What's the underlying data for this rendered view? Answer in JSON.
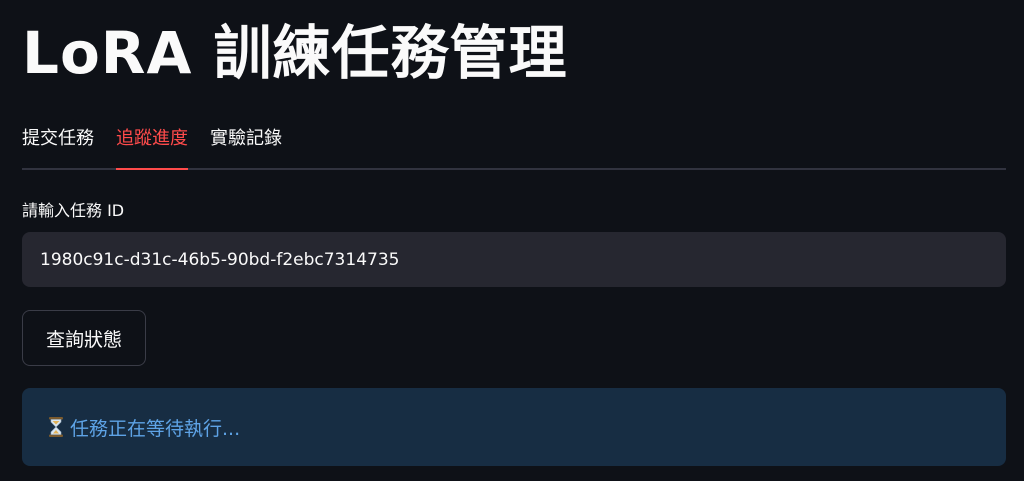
{
  "header": {
    "title": "LoRA 訓練任務管理"
  },
  "tabs": [
    {
      "label": "提交任務",
      "active": false
    },
    {
      "label": "追蹤進度",
      "active": true
    },
    {
      "label": "實驗記錄",
      "active": false
    }
  ],
  "form": {
    "task_id_label": "請輸入任務 ID",
    "task_id_value": "1980c91c-d31c-46b5-90bd-f2ebc7314735",
    "query_button_label": "查詢狀態"
  },
  "status": {
    "icon": "hourglass-icon",
    "message": "任務正在等待執行..."
  },
  "colors": {
    "background": "#0e1117",
    "accent": "#ff4b4b",
    "input_background": "#262730",
    "info_background": "#172d43",
    "info_text": "#5ea3e6"
  }
}
